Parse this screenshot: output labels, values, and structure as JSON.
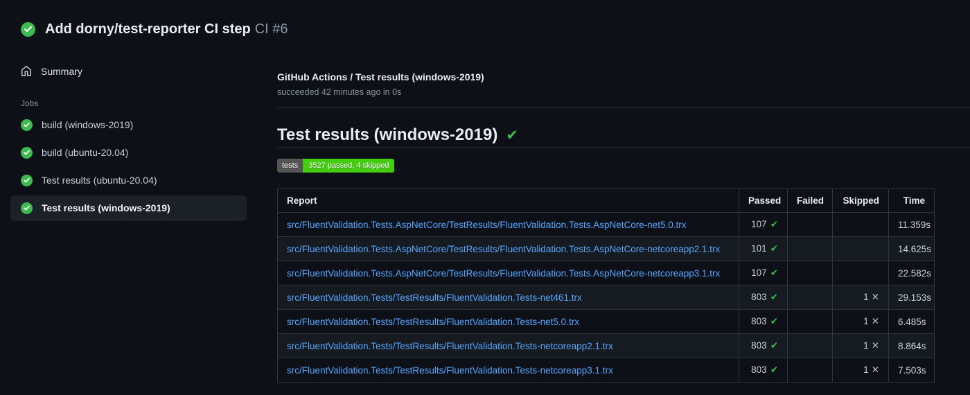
{
  "header": {
    "title": "Add dorny/test-reporter CI step",
    "run_number": "CI #6",
    "status_icon": "check-circle"
  },
  "sidebar": {
    "summary_label": "Summary",
    "jobs_label": "Jobs",
    "jobs": [
      {
        "label": "build (windows-2019)",
        "selected": false
      },
      {
        "label": "build (ubuntu-20.04)",
        "selected": false
      },
      {
        "label": "Test results (ubuntu-20.04)",
        "selected": false
      },
      {
        "label": "Test results (windows-2019)",
        "selected": true
      }
    ]
  },
  "main": {
    "breadcrumb": "GitHub Actions / Test results (windows-2019)",
    "status_line": "succeeded 42 minutes ago in 0s",
    "heading": "Test results (windows-2019)",
    "heading_check_glyph": "✔",
    "badge": {
      "label": "tests",
      "value": "3527 passed, 4 skipped",
      "label_bg": "#555555",
      "value_bg": "#44cc11"
    },
    "table": {
      "columns": [
        "Report",
        "Passed",
        "Failed",
        "Skipped",
        "Time"
      ],
      "pass_glyph": "✔",
      "skip_glyph": "✕",
      "rows": [
        {
          "report": "src/FluentValidation.Tests.AspNetCore/TestResults/FluentValidation.Tests.AspNetCore-net5.0.trx",
          "passed": "107",
          "failed": "",
          "skipped": "",
          "time": "11.359s"
        },
        {
          "report": "src/FluentValidation.Tests.AspNetCore/TestResults/FluentValidation.Tests.AspNetCore-netcoreapp2.1.trx",
          "passed": "101",
          "failed": "",
          "skipped": "",
          "time": "14.625s"
        },
        {
          "report": "src/FluentValidation.Tests.AspNetCore/TestResults/FluentValidation.Tests.AspNetCore-netcoreapp3.1.trx",
          "passed": "107",
          "failed": "",
          "skipped": "",
          "time": "22.582s"
        },
        {
          "report": "src/FluentValidation.Tests/TestResults/FluentValidation.Tests-net461.trx",
          "passed": "803",
          "failed": "",
          "skipped": "1",
          "time": "29.153s"
        },
        {
          "report": "src/FluentValidation.Tests/TestResults/FluentValidation.Tests-net5.0.trx",
          "passed": "803",
          "failed": "",
          "skipped": "1",
          "time": "6.485s"
        },
        {
          "report": "src/FluentValidation.Tests/TestResults/FluentValidation.Tests-netcoreapp2.1.trx",
          "passed": "803",
          "failed": "",
          "skipped": "1",
          "time": "8.864s"
        },
        {
          "report": "src/FluentValidation.Tests/TestResults/FluentValidation.Tests-netcoreapp3.1.trx",
          "passed": "803",
          "failed": "",
          "skipped": "1",
          "time": "7.503s"
        }
      ]
    }
  },
  "colors": {
    "background": "#0d1117",
    "success_green": "#3fb950",
    "link_blue": "#58a6ff",
    "border": "#30363d",
    "muted_text": "#8b949e",
    "selected_item_bg": "#1c2128"
  }
}
